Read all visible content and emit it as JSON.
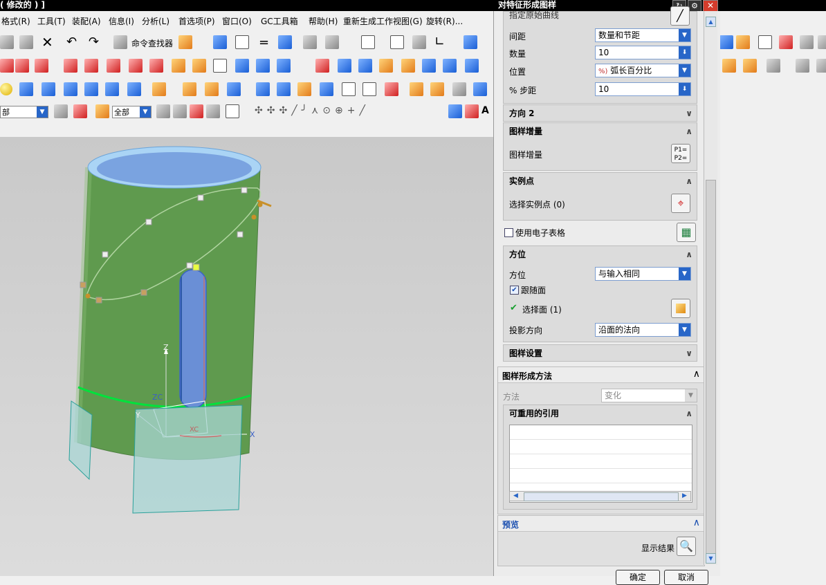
{
  "window": {
    "main_title": "( 修改的 )  ]",
    "dialog_title": "对特征形成图样"
  },
  "menubar": {
    "items": [
      "格式(R)",
      "工具(T)",
      "装配(A)",
      "信息(I)",
      "分析(L)",
      "首选项(P)",
      "窗口(O)",
      "GC工具箱",
      "帮助(H)",
      "重新生成工作视图(G)",
      "旋转(R)..."
    ]
  },
  "toolbar": {
    "command_finder_label": "命令查找器",
    "filter_left_value": "部",
    "filter_all_value": "全部",
    "label_A": "A"
  },
  "viewport": {
    "axis_z": "Z",
    "axis_zc": "ZC",
    "axis_y": "Y",
    "axis_x": "X",
    "axis_xc": "XC"
  },
  "dialog": {
    "top_partial_label": "指定原始曲线",
    "spacing_label": "间距",
    "spacing_value": "数量和节距",
    "count_label": "数量",
    "count_value": "10",
    "position_label": "位置",
    "position_value": "弧长百分比",
    "step_label": "% 步距",
    "step_value": "10",
    "direction2_header": "方向 2",
    "increment_header": "图样增量",
    "increment_label": "图样增量",
    "instance_header": "实例点",
    "instance_label": "选择实例点 (0)",
    "spreadsheet_label": "使用电子表格",
    "orientation_header": "方位",
    "orientation_label": "方位",
    "orientation_value": "与输入相同",
    "follow_face_label": "跟随面",
    "select_face_label": "选择面 (1)",
    "projection_label": "投影方向",
    "projection_value": "沿面的法向",
    "settings_header": "图样设置",
    "method_header": "图样形成方法",
    "method_label": "方法",
    "method_value": "变化",
    "reusable_header": "可重用的引用",
    "preview_header": "预览",
    "show_result_label": "显示结果",
    "ok_label": "确定",
    "cancel_label": "取消"
  },
  "colors": {
    "cylinder_green": "#5f9a4e",
    "hole_blue": "#7aa3e0",
    "panel_bg": "#ececec",
    "accent_blue": "#2866c8"
  }
}
